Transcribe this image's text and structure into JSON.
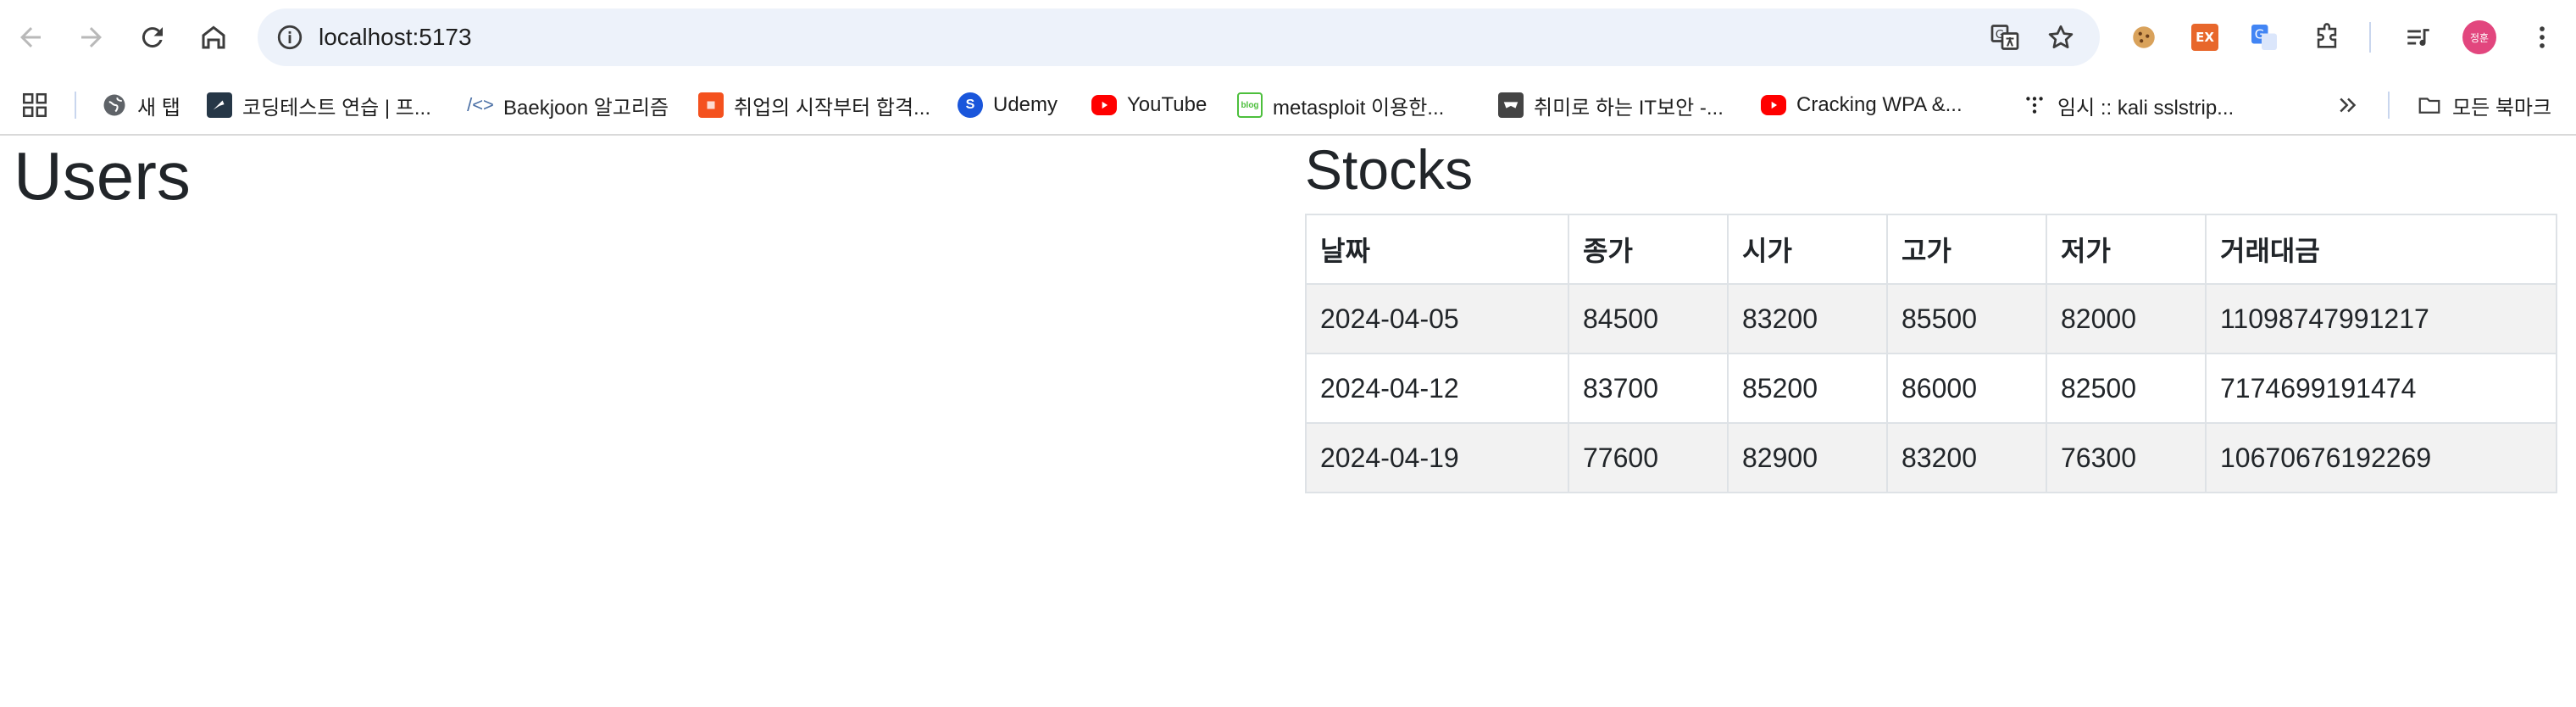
{
  "browser": {
    "url": "localhost:5173"
  },
  "bookmarks": [
    {
      "label": "새 탭",
      "icon": "globe-icon"
    },
    {
      "label": "코딩테스트 연습 | 프...",
      "icon": "programmers-icon"
    },
    {
      "label": "Baekjoon 알고리즘",
      "icon": "code-brackets-icon"
    },
    {
      "label": "취업의 시작부터 합격...",
      "icon": "orange-square-icon"
    },
    {
      "label": "Udemy",
      "icon": "udemy-icon"
    },
    {
      "label": "YouTube",
      "icon": "youtube-icon"
    },
    {
      "label": "metasploit 이용한...",
      "icon": "blog-icon"
    },
    {
      "label": "취미로 하는 IT보안 -...",
      "icon": "mask-icon"
    },
    {
      "label": "Cracking WPA &...",
      "icon": "youtube-icon"
    },
    {
      "label": "임시 :: kali sslstrip...",
      "icon": "tistory-icon"
    }
  ],
  "all_bookmarks_label": "모든 북마크",
  "profile_initials": "정훈",
  "ext_label": "EX",
  "users": {
    "title": "Users"
  },
  "stocks": {
    "title": "Stocks",
    "columns": [
      "날짜",
      "종가",
      "시가",
      "고가",
      "저가",
      "거래대금"
    ],
    "rows": [
      [
        "2024-04-05",
        "84500",
        "83200",
        "85500",
        "82000",
        "11098747991217"
      ],
      [
        "2024-04-12",
        "83700",
        "85200",
        "86000",
        "82500",
        "7174699191474"
      ],
      [
        "2024-04-19",
        "77600",
        "82900",
        "83200",
        "76300",
        "10670676192269"
      ]
    ]
  }
}
